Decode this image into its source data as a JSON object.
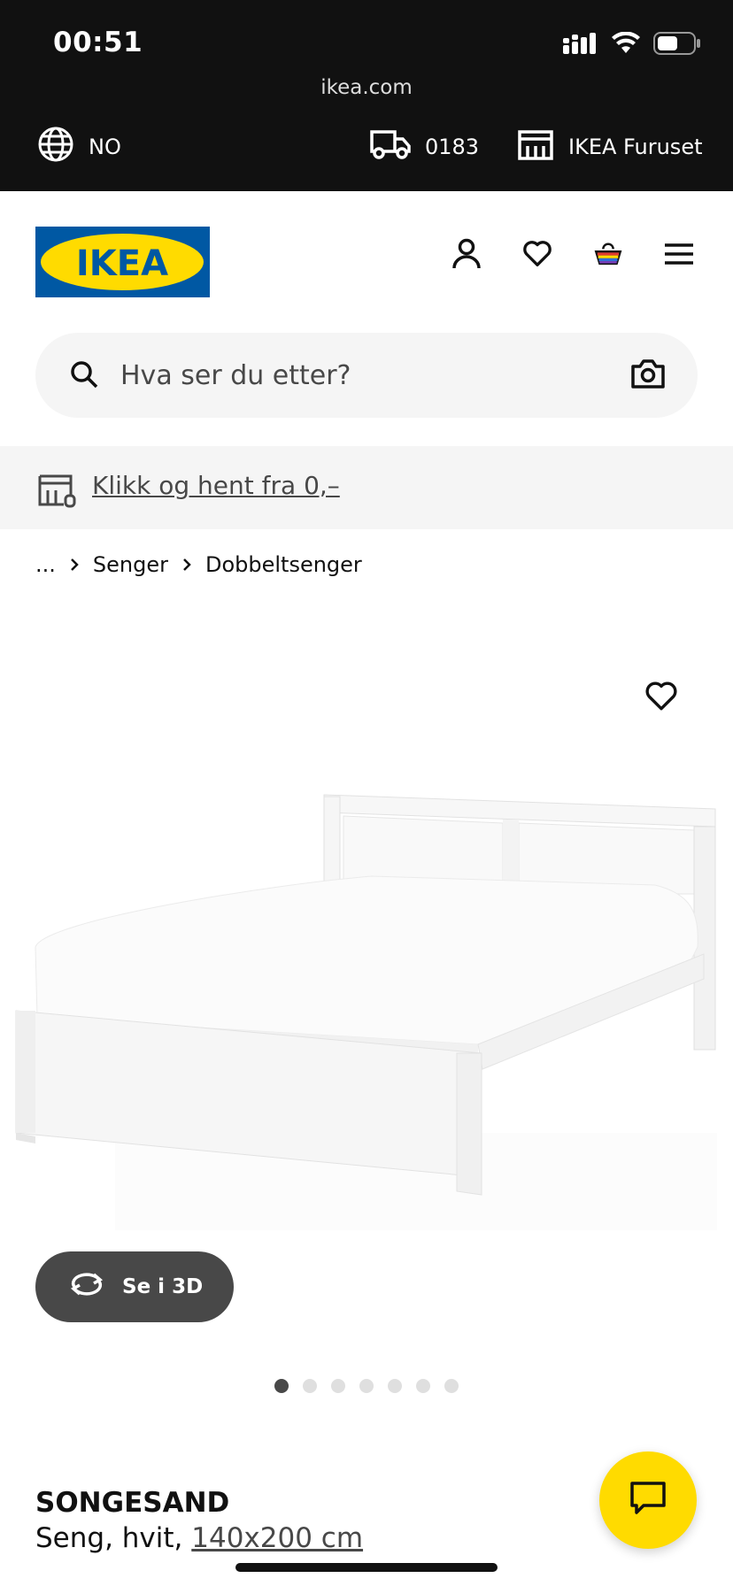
{
  "status_bar": {
    "time": "00:51"
  },
  "browser": {
    "url": "ikea.com"
  },
  "utility_bar": {
    "language": "NO",
    "postal_code": "0183",
    "store": "IKEA Furuset"
  },
  "header": {
    "logo_text": "IKEA",
    "brand_colors": {
      "blue": "#0058a3",
      "yellow": "#ffdb00"
    }
  },
  "search": {
    "placeholder": "Hva ser du etter?"
  },
  "promo": {
    "link_text": "Klikk og hent fra 0,–"
  },
  "breadcrumb": {
    "ellipsis": "...",
    "items": [
      "Senger",
      "Dobbeltsenger"
    ]
  },
  "gallery": {
    "view_3d_label": "Se i 3D",
    "dot_count": 7,
    "active_index": 0
  },
  "product": {
    "name": "SONGESAND",
    "desc_prefix": "Seng, hvit, ",
    "size": "140x200 cm"
  }
}
